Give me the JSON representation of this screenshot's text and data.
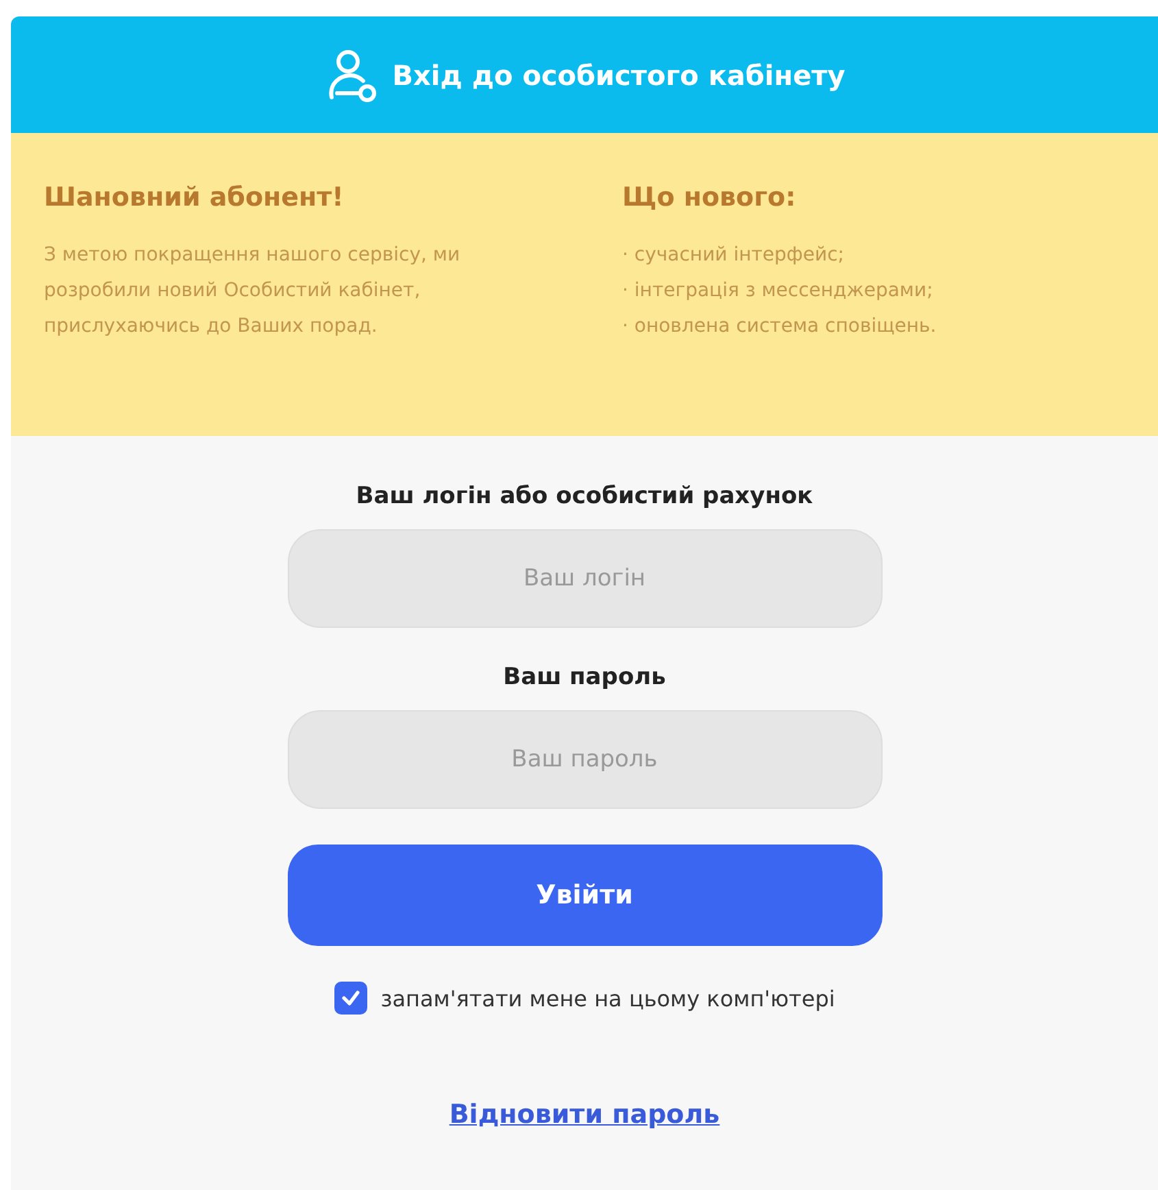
{
  "header": {
    "title": "Вхід до особистого кабінету"
  },
  "notice": {
    "greeting": "Шановний абонент!",
    "message": "З метою покращення нашого сервісу, ми розробили новий Особистий кабінет, прислухаючись до Ваших порад.",
    "news_title": "Що нового:",
    "news": [
      "· сучасний інтерфейс;",
      "· інтеграція з мессенджерами;",
      "· оновлена система сповіщень."
    ]
  },
  "form": {
    "fields": [
      {
        "label": "Ваш логін або особистий рахунок",
        "placeholder": "Ваш логін"
      },
      {
        "label": "Ваш пароль",
        "placeholder": "Ваш пароль"
      }
    ],
    "submit": "Увійти",
    "remember": {
      "label": "запам'ятати мене на цьому комп'ютері",
      "checked": true
    },
    "restore_link": "Відновити пароль"
  }
}
